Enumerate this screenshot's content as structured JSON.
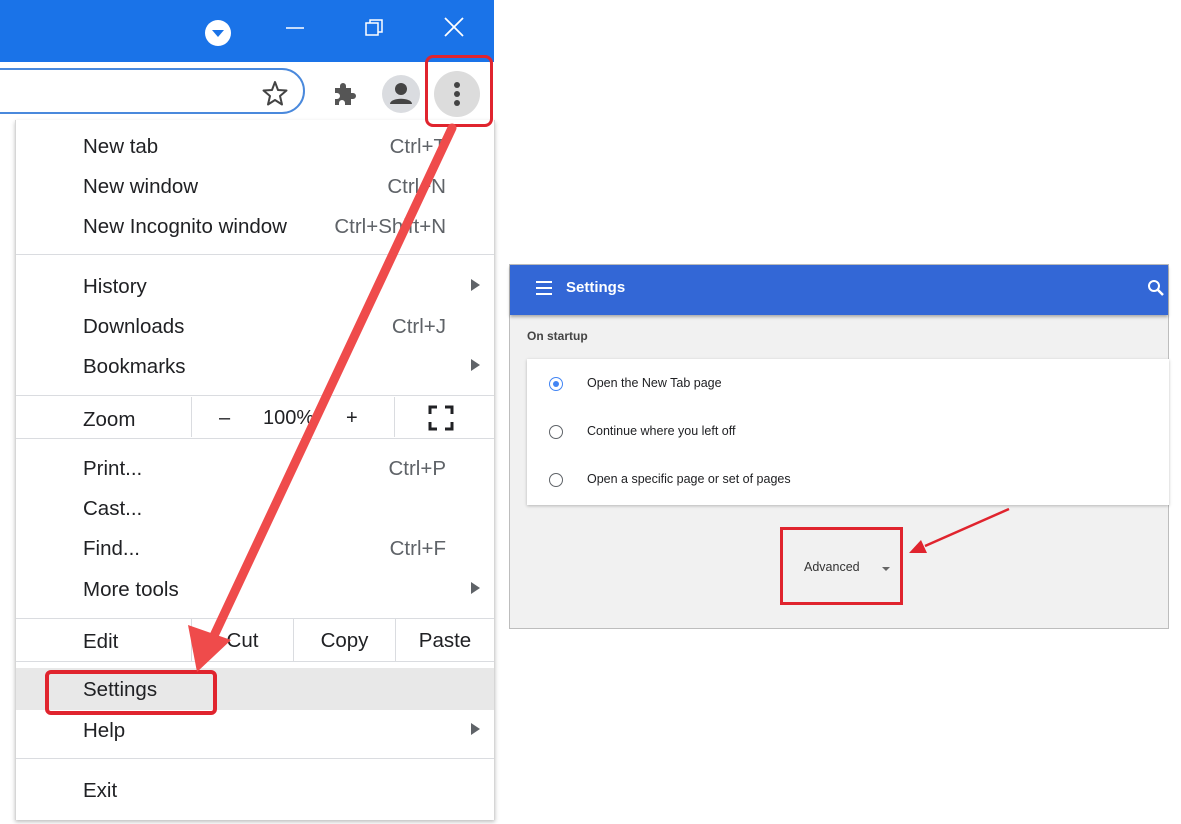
{
  "menu": {
    "items": [
      {
        "label": "New tab",
        "shortcut": "Ctrl+T"
      },
      {
        "label": "New window",
        "shortcut": "Ctrl+N"
      },
      {
        "label": "New Incognito window",
        "shortcut": "Ctrl+Shift+N"
      },
      {
        "label": "History",
        "submenu": true
      },
      {
        "label": "Downloads",
        "shortcut": "Ctrl+J"
      },
      {
        "label": "Bookmarks",
        "submenu": true
      }
    ],
    "zoom": {
      "label": "Zoom",
      "minus": "–",
      "value": "100%",
      "plus": "+"
    },
    "items2": [
      {
        "label": "Print...",
        "shortcut": "Ctrl+P"
      },
      {
        "label": "Cast..."
      },
      {
        "label": "Find...",
        "shortcut": "Ctrl+F"
      },
      {
        "label": "More tools",
        "submenu": true
      }
    ],
    "edit": {
      "label": "Edit",
      "cut": "Cut",
      "copy": "Copy",
      "paste": "Paste"
    },
    "settings": "Settings",
    "help": "Help",
    "exit": "Exit"
  },
  "settings_page": {
    "title": "Settings",
    "section": "On startup",
    "options": [
      {
        "label": "Open the New Tab page",
        "selected": true
      },
      {
        "label": "Continue where you left off",
        "selected": false
      },
      {
        "label": "Open a specific page or set of pages",
        "selected": false
      }
    ],
    "advanced": "Advanced"
  },
  "colors": {
    "titlebar": "#1a73e8",
    "settings_header": "#3367d6",
    "highlight": "#e0242e",
    "arrow": "#ef4b4b",
    "radio_selected": "#4285f4"
  },
  "icons": [
    "chevron-down-icon",
    "minimize-icon",
    "restore-icon",
    "close-icon",
    "star-icon",
    "extensions-icon",
    "profile-icon",
    "more-vert-icon",
    "fullscreen-icon",
    "submenu-arrow-icon",
    "hamburger-icon",
    "search-icon",
    "dropdown-caret-icon",
    "radio-icon"
  ]
}
